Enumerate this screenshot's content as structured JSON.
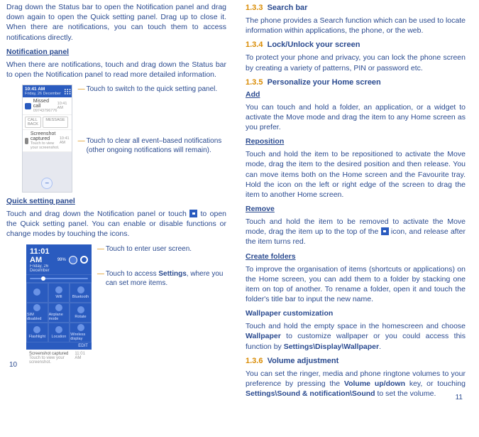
{
  "left": {
    "intro_para": "Drag down the Status bar to open the Notification panel and drag down again to open the Quick setting panel. Drag up to close it. When there are notifications, you can touch them to access notifications directly.",
    "h_notif_panel": "Notification panel",
    "notif_para": "When there are notifications, touch and drag down the Status bar to open the Notification panel to read more detailed information.",
    "annot_quick": "Touch to switch to the quick setting panel.",
    "annot_clear": "Touch to clear all event–based notifications (other ongoing notifications will remain).",
    "h_quick": "Quick setting panel",
    "quick_para_a": "Touch and drag down the Notification panel or touch ",
    "quick_para_b": " to open the Quick setting panel. You can enable or disable functions or change modes by touching the icons.",
    "annot_user": "Touch to enter user screen.",
    "annot_settings_a": "Touch to access ",
    "annot_settings_b": "Settings",
    "annot_settings_c": ", where you can set more items.",
    "mock": {
      "bar_time": "10:41 AM",
      "bar_date": "Friday, 26 December",
      "missed_title": "Missed call",
      "missed_num": "09743796776",
      "missed_time": "10:41 AM",
      "btn_call": "CALL BACK",
      "btn_msg": "MESSAGE",
      "shot_title": "Screenshot captured",
      "shot_sub": "Touch to view your screenshot.",
      "shot_time": "10:41 AM"
    },
    "qs": {
      "time": "11:01 AM",
      "date": "Friday, 26 December",
      "batt": "99%",
      "cells": [
        "",
        "Wifi",
        "Bluetooth",
        "SIM disabled",
        "Airplane mode",
        "Rotate",
        "Flashlight",
        "Location",
        "Wireless display"
      ],
      "edit": "EDIT",
      "shot_title": "Screenshot captured",
      "shot_sub": "Touch to view your screenshot.",
      "shot_time": "11:01 AM"
    },
    "pagenum": "10"
  },
  "right": {
    "s133_num": "1.3.3",
    "s133_title": "Search bar",
    "s133_p": "The phone provides a Search function which can be used to locate information within applications, the phone, or the web.",
    "s134_num": "1.3.4",
    "s134_title": "Lock/Unlock your screen",
    "s134_p": "To protect your phone and privacy, you can lock the phone screen by creating a variety of patterns, PIN or password etc.",
    "s135_num": "1.3.5",
    "s135_title": "Personalize your Home screen",
    "add_h": "Add",
    "add_p": "You can touch and hold a folder, an application, or a widget to activate the Move mode and drag the item to any Home screen as you prefer.",
    "rep_h": "Reposition",
    "rep_p": "Touch and hold the item to be repositioned to activate the Move mode, drag the item to the desired position and then release. You can move items both on the Home screen and the Favourite tray. Hold the icon on the left or right edge of the screen to drag the item to another Home screen.",
    "rem_h": "Remove",
    "rem_p_a": "Touch and hold the item to be removed to activate the Move mode, drag the item up to the top of the ",
    "rem_p_b": " icon, and release after the item turns red.",
    "fold_h": "Create folders",
    "fold_p": "To improve the organisation of items (shortcuts or applications) on the Home screen, you can add them to a folder by stacking one item on top of another. To rename a folder, open it and touch the folder's title bar to input the new name.",
    "wall_h": "Wallpaper customization",
    "wall_p_a": "Touch and hold the empty space in the homescreen and choose ",
    "wall_p_b": "Wallpaper",
    "wall_p_c": " to customize wallpaper or you could access this function by ",
    "wall_p_d": "Settings\\Display\\Wallpaper",
    "wall_p_e": ".",
    "s136_num": "1.3.6",
    "s136_title": "Volume adjustment",
    "vol_p_a": "You can set the ringer, media and phone ringtone volumes to your preference by pressing the ",
    "vol_p_b": "Volume up/down",
    "vol_p_c": " key, or touching ",
    "vol_p_d": "Settings\\Sound & notification\\Sound",
    "vol_p_e": " to set the volume.",
    "pagenum": "11"
  }
}
